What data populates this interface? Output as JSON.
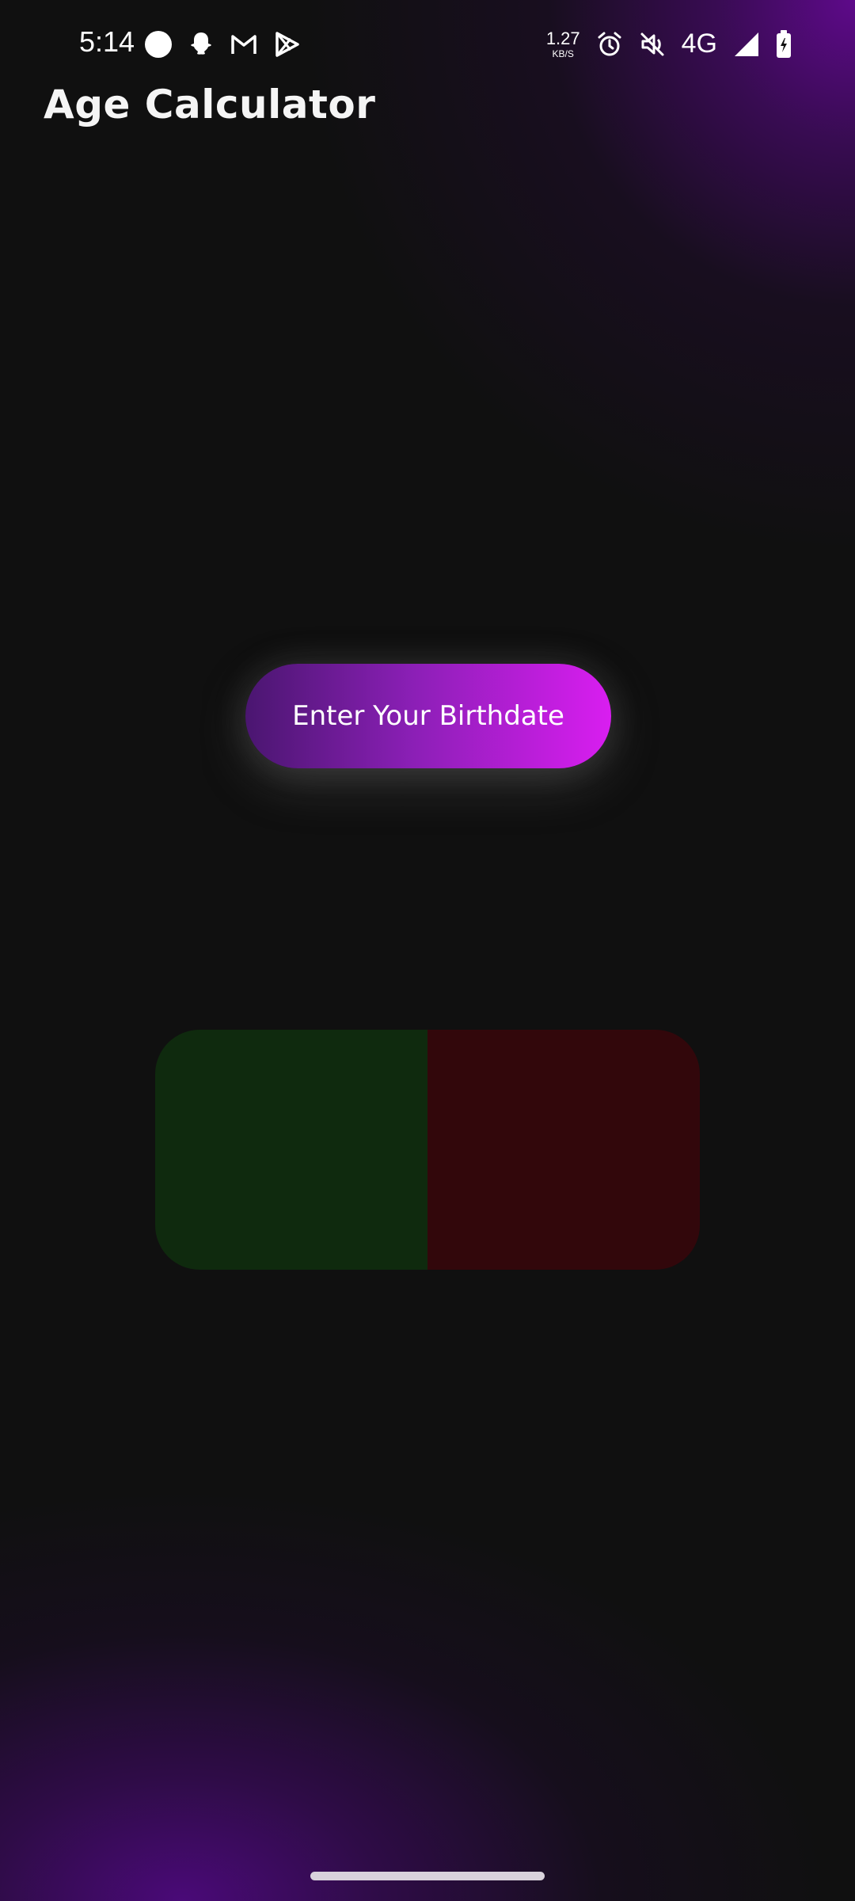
{
  "status_bar": {
    "time": "5:14",
    "net_speed_value": "1.27",
    "net_speed_unit": "KB/S",
    "network_type": "4G",
    "left_icons": [
      "circle-notification-icon",
      "snapchat-icon",
      "gmail-icon",
      "play-store-icon"
    ],
    "right_icons": [
      "alarm-icon",
      "mute-icon",
      "signal-icon",
      "battery-charging-icon"
    ]
  },
  "app": {
    "title": "Age Calculator"
  },
  "main": {
    "birthdate_button_label": "Enter Your Birthdate"
  },
  "result_card": {
    "left_color": "#0f2a0e",
    "right_color": "#32070b"
  },
  "theme": {
    "accent_start": "#4a1670",
    "accent_end": "#d91ef0",
    "background": "#101010"
  }
}
